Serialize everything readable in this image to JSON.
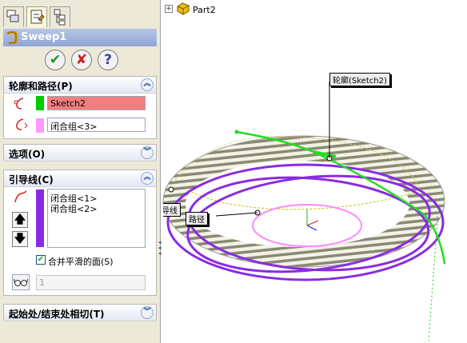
{
  "tabs": [
    {
      "icon": "feature-manager-icon"
    },
    {
      "icon": "property-manager-icon"
    },
    {
      "icon": "configuration-manager-icon"
    }
  ],
  "property_manager": {
    "title": "Sweep1",
    "ok": "✔",
    "cancel": "✘",
    "help": "?"
  },
  "profile_path": {
    "header": "轮廓和路径(P)",
    "profile_value": "Sketch2",
    "path_value": "闭合组<3>",
    "profile_color": "#00cc00",
    "path_color": "#ff99ff",
    "highlight": "#f08080"
  },
  "options": {
    "header": "选项(O)"
  },
  "guide_curves": {
    "header": "引导线(C)",
    "items": [
      "闭合组<1>",
      "闭合组<2>"
    ],
    "color": "#8a2be2",
    "merge_label": "合并平滑的面(S)",
    "merge_checked": true,
    "count_value": "1"
  },
  "tangency": {
    "header": "起始处/结束处相切(T)"
  },
  "tree": {
    "expand": "+",
    "part": "Part2"
  },
  "viewport": {
    "callout_profile": "轮廓(Sketch2)",
    "callout_path": "路径",
    "callout_guide": "引导线"
  }
}
